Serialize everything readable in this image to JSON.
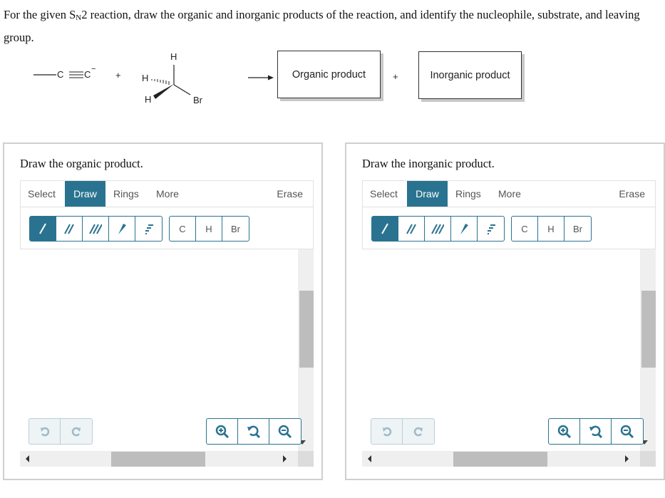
{
  "question": {
    "prefix": "For the given S",
    "subscript": "N",
    "suffix": "2 reaction, draw the organic and inorganic products of the reaction, and identify the nucleophile, substrate, and leaving group."
  },
  "reaction": {
    "nucleophile": {
      "c1": "C",
      "c2": "C",
      "charge": "−"
    },
    "plus1": "+",
    "substrate": {
      "h_top": "H",
      "h_left": "H",
      "h_bottom": "H",
      "leaving": "Br"
    },
    "plus2": "+",
    "organic_product_label": "Organic product",
    "inorganic_product_label": "Inorganic product"
  },
  "panels": [
    {
      "title": "Draw the organic product.",
      "tabs": [
        "Select",
        "Draw",
        "Rings",
        "More"
      ],
      "active_tab": "Draw",
      "erase_label": "Erase",
      "bond_tools": [
        "single-bond",
        "double-bond",
        "triple-bond",
        "wedge-bond",
        "hash-bond"
      ],
      "atoms": [
        "C",
        "H",
        "Br"
      ]
    },
    {
      "title": "Draw the inorganic product.",
      "tabs": [
        "Select",
        "Draw",
        "Rings",
        "More"
      ],
      "active_tab": "Draw",
      "erase_label": "Erase",
      "bond_tools": [
        "single-bond",
        "double-bond",
        "triple-bond",
        "wedge-bond",
        "hash-bond"
      ],
      "atoms": [
        "C",
        "H",
        "Br"
      ]
    }
  ],
  "colors": {
    "accent": "#2a7390",
    "scroll_track": "#efefef",
    "scroll_thumb": "#bdbdbd"
  }
}
